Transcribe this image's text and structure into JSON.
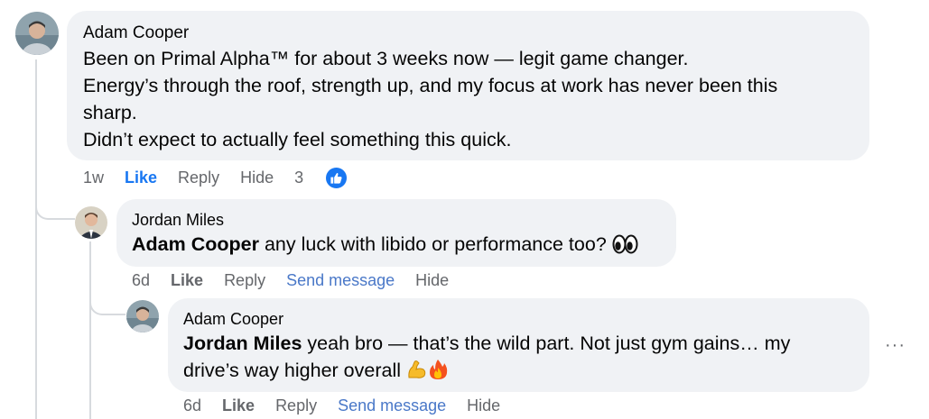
{
  "comments": [
    {
      "author": "Adam Cooper",
      "lines": [
        "Been on Primal Alpha™ for about 3 weeks now — legit game changer.",
        "Energy’s through the roof, strength up, and my focus at work has never been this",
        "sharp.",
        "Didn’t expect to actually feel something this quick."
      ],
      "time": "1w",
      "like_label": "Like",
      "reply_label": "Reply",
      "hide_label": "Hide",
      "reaction_count": "3"
    },
    {
      "author": "Jordan Miles",
      "mention": "Adam Cooper",
      "text": " any luck with libido or performance too?",
      "emoji": "eyes",
      "time": "6d",
      "like_label": "Like",
      "reply_label": "Reply",
      "send_label": "Send message",
      "hide_label": "Hide"
    },
    {
      "author": "Adam Cooper",
      "mention": "Jordan Miles",
      "text": " yeah bro — that’s the wild part. Not just gym gains… my",
      "line2": "drive’s way higher overall",
      "emojis": [
        "flexed-biceps",
        "fire"
      ],
      "time": "6d",
      "like_label": "Like",
      "reply_label": "Reply",
      "send_label": "Send message",
      "hide_label": "Hide"
    }
  ],
  "more_label": "···",
  "colors": {
    "bubble": "#f0f2f5",
    "accent": "#1877f2",
    "secondary_text": "#65676b",
    "thread_line": "#d7dade"
  }
}
